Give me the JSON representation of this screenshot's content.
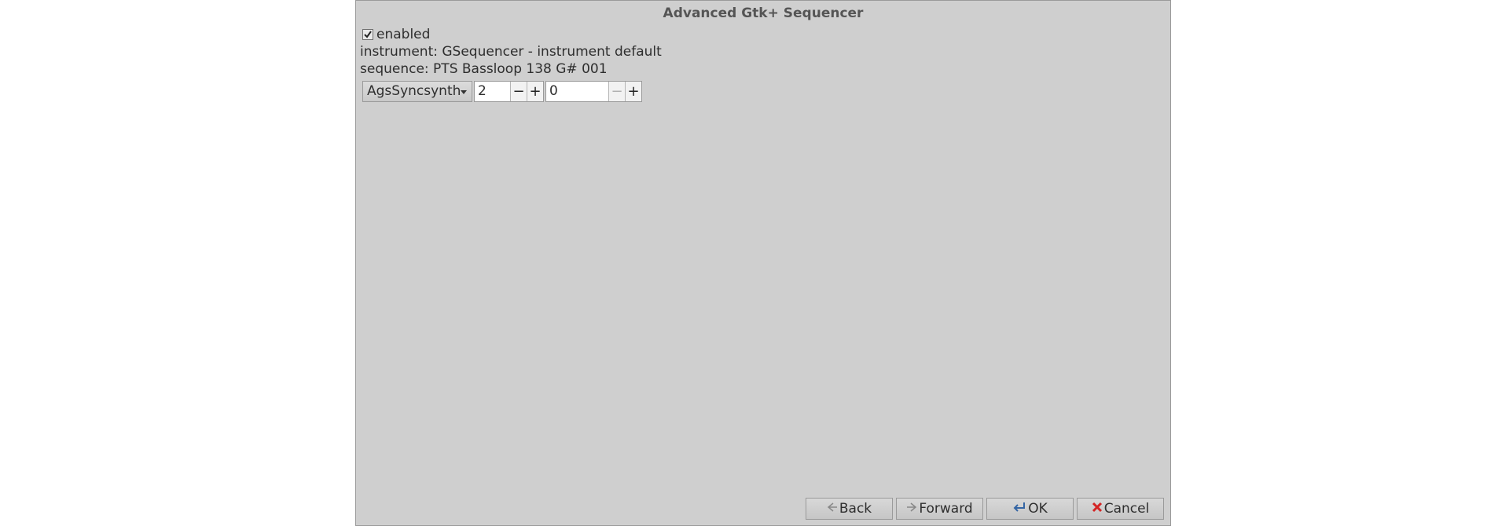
{
  "window": {
    "title": "Advanced Gtk+ Sequencer"
  },
  "form": {
    "enabled_label": "enabled",
    "enabled_checked": true,
    "instrument_label": "instrument: GSequencer - instrument default",
    "sequence_label": "sequence: PTS Bassloop 138 G# 001",
    "synth_select": {
      "selected": "AgsSyncsynth",
      "icon": "chevron-down-icon"
    },
    "spin1": {
      "value": "2",
      "minus": "−",
      "plus": "+"
    },
    "spin2": {
      "value": "0",
      "minus": "−",
      "plus": "+"
    }
  },
  "buttons": {
    "back": {
      "label": "Back",
      "icon": "back-arrow-icon"
    },
    "forward": {
      "label": "Forward",
      "icon": "forward-arrow-icon"
    },
    "ok": {
      "label": "OK",
      "icon": "enter-icon"
    },
    "cancel": {
      "label": "Cancel",
      "icon": "cancel-x-icon"
    }
  },
  "colors": {
    "window_bg": "#cfcfcf",
    "cancel_icon": "#d42525",
    "ok_icon": "#3465a4"
  }
}
